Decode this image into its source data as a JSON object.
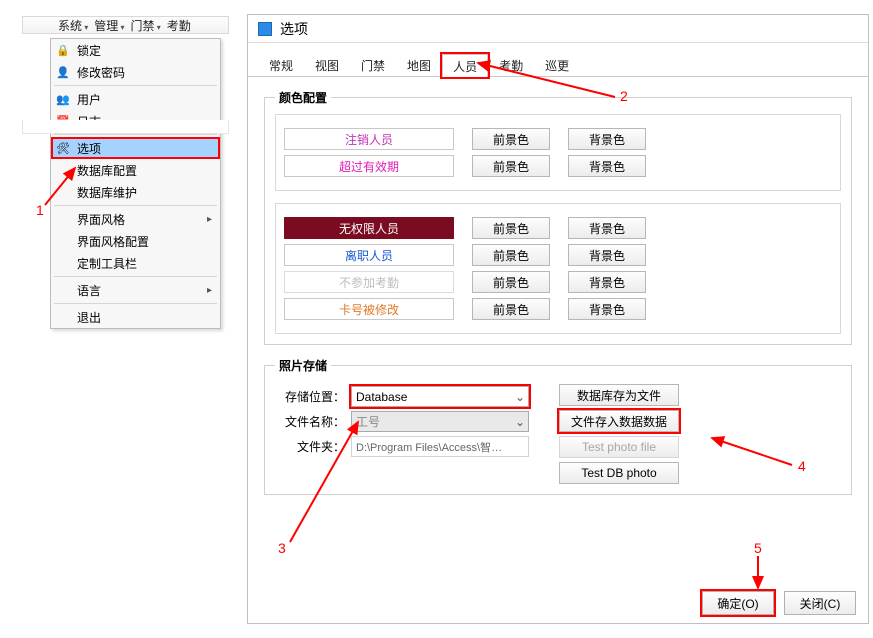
{
  "menubar": {
    "items": [
      "系统",
      "管理",
      "门禁",
      "考勤"
    ]
  },
  "dropdown": {
    "items": [
      {
        "label": "锁定",
        "icon": "🔒"
      },
      {
        "label": "修改密码",
        "icon": "👤"
      },
      {
        "sep": true
      },
      {
        "label": "用户",
        "icon": "👥"
      },
      {
        "label": "日志",
        "icon": "📅"
      },
      {
        "sep": true
      },
      {
        "label": "选项",
        "icon": "🛠",
        "highlight": true
      },
      {
        "label": "数据库配置",
        "icon": ""
      },
      {
        "label": "数据库维护",
        "icon": ""
      },
      {
        "sep": true
      },
      {
        "label": "界面风格",
        "icon": "",
        "submenu": true
      },
      {
        "label": "界面风格配置",
        "icon": ""
      },
      {
        "label": "定制工具栏",
        "icon": ""
      },
      {
        "sep": true
      },
      {
        "label": "语言",
        "icon": "",
        "submenu": true
      },
      {
        "sep": true
      },
      {
        "label": "退出",
        "icon": ""
      }
    ]
  },
  "dialog": {
    "title": "选项",
    "tabs": [
      "常规",
      "视图",
      "门禁",
      "地图",
      "人员",
      "考勤",
      "巡更"
    ],
    "active_tab": 4,
    "color_section": {
      "legend": "颜色配置",
      "group1": [
        {
          "label": "注销人员",
          "color": "#c334b4"
        },
        {
          "label": "超过有效期",
          "color": "#e21bb5"
        }
      ],
      "group2": [
        {
          "label": "无权限人员",
          "filled": true
        },
        {
          "label": "离职人员",
          "color": "#1857d6"
        },
        {
          "label": "不参加考勤",
          "disabled": true
        },
        {
          "label": "卡号被修改",
          "color": "#e07a28"
        }
      ],
      "fg_btn": "前景色",
      "bg_btn": "背景色"
    },
    "photo_section": {
      "legend": "照片存储",
      "loc_label": "存储位置：",
      "loc_value": "Database",
      "name_label": "文件名称：",
      "name_value": "工号",
      "dir_label": "文件夹：",
      "dir_value": "D:\\Program Files\\Access\\智…",
      "btn_save_file": "数据库存为文件",
      "btn_load_db": "文件存入数据数据",
      "btn_test_file": "Test photo file",
      "btn_test_db": "Test DB photo"
    },
    "footer": {
      "ok": "确定(O)",
      "close": "关闭(C)"
    }
  },
  "annotations": {
    "n1": "1",
    "n2": "2",
    "n3": "3",
    "n4": "4",
    "n5": "5"
  }
}
